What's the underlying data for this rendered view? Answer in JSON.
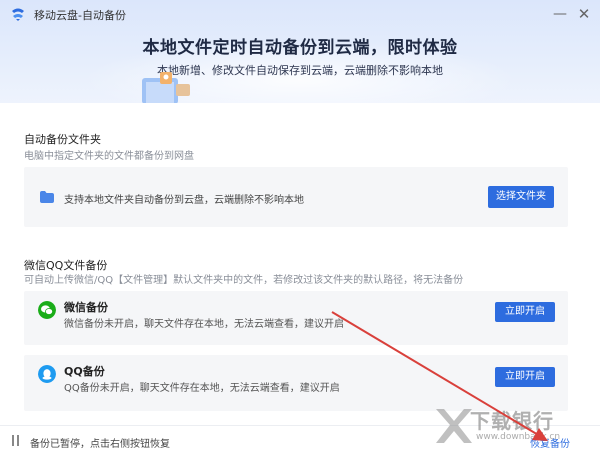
{
  "window": {
    "title": "移动云盘-自动备份",
    "minimize_glyph": "—",
    "close_glyph": "✕"
  },
  "banner": {
    "headline": "本地文件定时自动备份到云端，限时体验",
    "subline": "本地新增、修改文件自动保存到云端，云端删除不影响本地"
  },
  "folder_section": {
    "title": "自动备份文件夹",
    "desc": "电脑中指定文件夹的文件都备份到网盘",
    "card_text": "支持本地文件夹自动备份到云盘，云端删除不影响本地",
    "button": "选择文件夹"
  },
  "wechat_section": {
    "title": "微信QQ文件备份",
    "desc": "可自动上传微信/QQ【文件管理】默认文件夹中的文件，若修改过该文件夹的默认路径，将无法备份",
    "items": [
      {
        "title": "微信备份",
        "desc": "微信备份未开启，聊天文件存在本地，无法云端查看，建议开启",
        "button": "立即开启",
        "icon": "wechat-icon"
      },
      {
        "title": "QQ备份",
        "desc": "QQ备份未开启，聊天文件存在本地，无法云端查看，建议开启",
        "button": "立即开启",
        "icon": "qq-icon"
      }
    ]
  },
  "status": {
    "text": "备份已暂停，点击右侧按钮恢复",
    "action": "恢复备份"
  },
  "watermark": {
    "text": "下载银行",
    "url": "www.downbank.cn"
  },
  "colors": {
    "accent": "#2d6cdf",
    "wechat": "#1aad19",
    "qq": "#1e9bf0",
    "arrow": "#d9403b"
  }
}
